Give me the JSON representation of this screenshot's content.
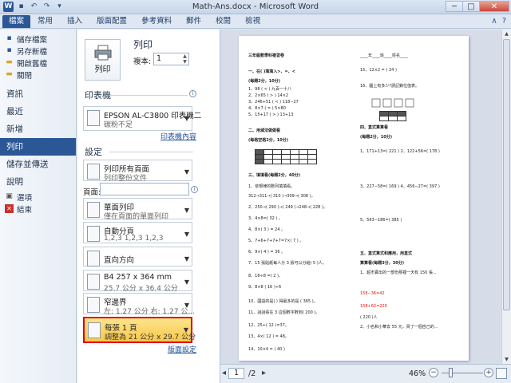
{
  "titlebar": {
    "title": "Math-Ans.docx - Microsoft Word",
    "qat_icons": [
      "word-icon",
      "save-icon",
      "undo-icon",
      "redo-icon",
      "customize-icon"
    ],
    "minimize": "─",
    "maximize": "□",
    "close": "✕"
  },
  "ribbon": {
    "tabs": [
      "檔案",
      "常用",
      "插入",
      "版面配置",
      "參考資料",
      "郵件",
      "校閱",
      "檢視"
    ],
    "min_glyph": "∧",
    "help_glyph": "?"
  },
  "nav": {
    "small_items": [
      {
        "label": "儲存檔案",
        "icon": "save-icon"
      },
      {
        "label": "另存新檔",
        "icon": "save-as-icon"
      },
      {
        "label": "開啟舊檔",
        "icon": "open-folder-icon"
      },
      {
        "label": "關閉",
        "icon": "close-file-icon"
      }
    ],
    "big_items": [
      "資訊",
      "最近",
      "新增",
      "列印",
      "儲存並傳送",
      "說明"
    ],
    "active": "列印",
    "bottom_items": [
      {
        "label": "選項",
        "icon": "options-icon"
      },
      {
        "label": "結束",
        "icon": "exit-icon"
      }
    ]
  },
  "print": {
    "button_label": "列印",
    "title": "列印",
    "copies_label": "複本:",
    "copies_value": "1",
    "printer_heading": "印表機",
    "printer_name": "EPSON AL-C3800 印表機二",
    "printer_status": "碳粉不足",
    "printer_props_link": "印表機內容",
    "settings_heading": "設定",
    "pages_label": "頁面:",
    "pages_value": "",
    "settings": [
      {
        "l1": "列印所有頁面",
        "l2": "列印整份文件",
        "name": "print-all-pages-dropdown"
      },
      {
        "l1": "單面列印",
        "l2": "僅在頁面的單面列印",
        "name": "one-sided-dropdown"
      },
      {
        "l1": "自動分頁",
        "l2": "1,2,3    1,2,3    1,2,3",
        "name": "collated-dropdown"
      },
      {
        "l1": "直向方向",
        "l2": "",
        "name": "orientation-dropdown"
      },
      {
        "l1": "B4 257 x 364 mm",
        "l2": "25.7 公分 x 36.4 公分",
        "name": "paper-size-dropdown"
      },
      {
        "l1": "窄邊界",
        "l2": "左: 1.27 公分  右: 1.27 公...",
        "name": "margins-dropdown"
      },
      {
        "l1": "每張 1 頁",
        "l2": "調整為 21 公分 x 29.7 公分",
        "name": "pages-per-sheet-dropdown"
      }
    ],
    "page_setup_link": "版面設定"
  },
  "preview": {
    "left_col": [
      {
        "t": "三年級數學科複習卷",
        "red": false,
        "b": true
      },
      {
        "t": "一、在(  )填填入>、=、<",
        "red": false,
        "b": true
      },
      {
        "t": "(每題2分，10分)",
        "red": false,
        "b": true
      },
      {
        "t": "1、98 ( < ) 九百一十八",
        "red": false
      },
      {
        "t": "2、2×65 ( > ) 14×2",
        "red": false
      },
      {
        "t": "3、246+51 ( < ) 118−27",
        "red": false
      },
      {
        "t": "4、8×7 ( = ) 5×80",
        "red": false
      },
      {
        "t": "5、15+17 ( > ) 13+13",
        "red": false
      },
      {
        "t": "二、用減法做做看",
        "red": false,
        "b": true
      },
      {
        "t": "(每格空格2分，10分)",
        "red": false,
        "b": true
      },
      {
        "t": "三、填填看(每題2分，40分)",
        "red": false,
        "b": true
      },
      {
        "t": "1、依規律的數列填填看。",
        "red": false
      },
      {
        "t": "312→311→( 310 )→309→( 308 )。",
        "red": false
      },
      {
        "t": "2、250→( 290 )→( 249 )→248→( 228 )。",
        "red": false
      },
      {
        "t": "3、4×8=( 32 ) 。",
        "red": false
      },
      {
        "t": "4、8×( 3 ) = 24 。",
        "red": false
      },
      {
        "t": "5、7+6+7+7+7=7×( 7 ) 。",
        "red": false
      },
      {
        "t": "6、9×( 4 ) = 36 。",
        "red": false
      },
      {
        "t": "7、15 張貼紙每人分 3 張可以分給( 5 )人。",
        "red": false
      },
      {
        "t": "8、16÷8 =( 2 )。",
        "red": false
      },
      {
        "t": "9、8×8 ( 16 )÷6",
        "red": false
      },
      {
        "t": "10、國語的是(   ) 得最多的是 ( 365 )。",
        "red": false
      },
      {
        "t": "11、說說看在 3 這個數字數到( 200 )。",
        "red": false
      },
      {
        "t": "12、25+( 12 )=37。",
        "red": false
      },
      {
        "t": "13、4×( 12 ) = 48。",
        "red": false
      },
      {
        "t": "14、10×4 = ( 40 )",
        "red": false
      }
    ],
    "right_col": [
      {
        "t": "____年____班____姓名____",
        "red": false
      },
      {
        "t": "15、12×2 = ( 24 )",
        "red": false
      },
      {
        "t": "16、圖上有多少?請記錄位值表。",
        "red": false
      },
      {
        "t": "四、直式算算看",
        "red": false,
        "b": true
      },
      {
        "t": "(每題2分，10分)",
        "red": false,
        "b": true
      },
      {
        "t": "1、171+13=( 221 )  2、122+56=( 178 )",
        "red": false
      },
      {
        "t": "3、227−58=( 169 )  4、456−27=( 397 )",
        "red": false
      },
      {
        "t": "5、563−186=( 385 )",
        "red": false
      },
      {
        "t": "五、直式算式和應用，用直式",
        "red": false,
        "b": true
      },
      {
        "t": "算算看(每題3分，30分)",
        "red": false,
        "b": true
      },
      {
        "t": "1、超市賣出的一部份那裡一天有 150 張...",
        "red": false
      },
      {
        "t": "158−36=42",
        "red": true
      },
      {
        "t": "158+62=220",
        "red": true
      },
      {
        "t": "( 220 )人",
        "red": false
      },
      {
        "t": "2、小名和小華去 55 元，買了一個自己的...",
        "red": false
      }
    ]
  },
  "status": {
    "page_current": "1",
    "page_total": "/2",
    "zoom": "46%",
    "zoom_level": 0.46
  }
}
